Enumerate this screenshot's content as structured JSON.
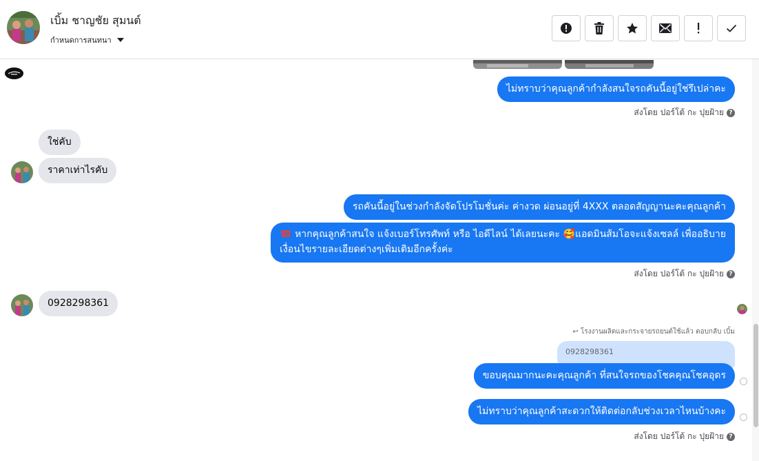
{
  "header": {
    "contact_name": "เบิ้ม ชาญชัย สุมนต์",
    "assign_label": "กำหนดการสนทนา",
    "actions": [
      {
        "name": "spam-button",
        "icon": "alert-circle-icon"
      },
      {
        "name": "delete-button",
        "icon": "trash-icon"
      },
      {
        "name": "star-button",
        "icon": "star-icon"
      },
      {
        "name": "mark-unread-button",
        "icon": "envelope-icon"
      },
      {
        "name": "follow-up-button",
        "icon": "exclamation-icon"
      },
      {
        "name": "mark-done-button",
        "icon": "checkmark-icon"
      }
    ]
  },
  "messages": {
    "out_1": "ไม่ทราบว่าคุณลูกค้ากำลังสนใจรถคันนี้อยู่ใช่รึเปล่าคะ",
    "sent_by_1": "ส่งโดย ปอร์โต้ กะ ปุยฝ้าย",
    "in_1": "ใช่คับ",
    "in_2": "ราคาเท่าไรคับ",
    "out_2": "รถคันนี้อยู่ในช่วงกำลังจัดโปรโมชั่นค่ะ ค่างวด ผ่อนอยู่ที่ 4XXX ตลอดสัญญานะคะคุณลูกค้า",
    "out_3_line1": "หากคุณลูกค้าสนใจ แจ้งเบอร์โทรศัพท์ หรือ ไอดีไลน์  ได้เลยนะคะ",
    "out_3_line1b": "แอดมินส้มโอจะแจ้งเซลล์   เพื่ออธิบาย",
    "out_3_line2": "เงื่อนไขรายละเอียดต่างๆเพิ่มเติมอีกครั้งค่ะ",
    "sent_by_2": "ส่งโดย ปอร์โต้ กะ ปุยฝ้าย",
    "in_3": "0928298361",
    "reply_context": "โรงงานผลิตและกระจายรถยนต์ใช้แล้ว ตอบกลับ เบิ้ม",
    "quoted": "0928298361",
    "out_4": "ขอบคุณมากนะคะคุณลูกค้า ที่สนใจรถของโชคคุณโชคอุดร",
    "out_5": "ไม่ทราบว่าคุณลูกค้าสะดวกให้ติดต่อกลับช่วงเวลาไหนบ้างคะ",
    "sent_by_3": "ส่งโดย ปอร์โต้ กะ ปุยฝ้าย",
    "help_glyph": "?",
    "emoji_phone": "☎",
    "emoji_face": "🥰",
    "reply_icon_glyph": "↩"
  },
  "colors": {
    "outgoing": "#1877f2",
    "incoming": "#e4e6eb",
    "quoted": "#cfe2fd"
  }
}
